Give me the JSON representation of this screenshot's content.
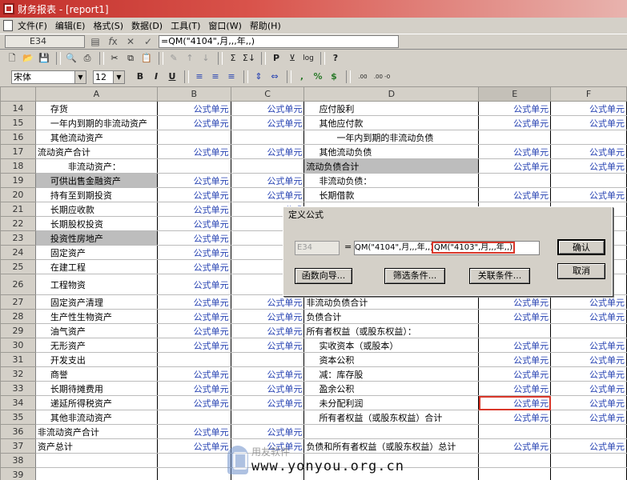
{
  "window": {
    "title": "财务报表 - [report1]"
  },
  "menu": [
    "文件(F)",
    "编辑(E)",
    "格式(S)",
    "数据(D)",
    "工具(T)",
    "窗口(W)",
    "帮助(H)"
  ],
  "formula_bar": {
    "cell_ref": "E34",
    "formula": "=QM(\"4104\",月,,,年,,)"
  },
  "toolbar": {
    "font_name": "宋体",
    "font_size": "12",
    "bold": "B",
    "italic": "I",
    "underline": "U",
    "comma": ",",
    "percent": "%",
    "dollar": "$",
    "dec_inc": ".00 +0",
    "dec_dec": ".00 -0",
    "print": "P",
    "log": "log",
    "help": "?"
  },
  "columns": [
    "A",
    "B",
    "C",
    "D",
    "E",
    "F"
  ],
  "formula_cell": "公式单元",
  "rows": [
    {
      "n": "14",
      "a": "存货",
      "b": "公式单元",
      "c": "公式单元",
      "d": "应付股利",
      "e": "公式单元",
      "f": "公式单元"
    },
    {
      "n": "15",
      "a": "一年内到期的非流动资产",
      "b": "公式单元",
      "c": "公式单元",
      "d": "其他应付款",
      "e": "公式单元",
      "f": "公式单元"
    },
    {
      "n": "16",
      "a": "其他流动资产",
      "b": "",
      "c": "",
      "d": "一年内到期的非流动负债",
      "e": "",
      "f": ""
    },
    {
      "n": "17",
      "a": "流动资产合计",
      "b": "公式单元",
      "c": "公式单元",
      "d": "其他流动负债",
      "e": "公式单元",
      "f": "公式单元"
    },
    {
      "n": "18",
      "a": "非流动资产：",
      "b": "",
      "c": "",
      "d": "流动负债合计",
      "e": "公式单元",
      "f": "公式单元"
    },
    {
      "n": "19",
      "a": "可供出售金融资产",
      "b": "公式单元",
      "c": "公式单元",
      "d": "非流动负债：",
      "e": "",
      "f": ""
    },
    {
      "n": "20",
      "a": "持有至到期投资",
      "b": "公式单元",
      "c": "公式单元",
      "d": "长期借款",
      "e": "公式单元",
      "f": "公式单元"
    },
    {
      "n": "21",
      "a": "长期应收款",
      "b": "公式单元",
      "c": "公式",
      "d": "",
      "e": "",
      "f": ""
    },
    {
      "n": "22",
      "a": "长期股权投资",
      "b": "公式单元",
      "c": "公式",
      "d": "",
      "e": "",
      "f": ""
    },
    {
      "n": "23",
      "a": "投资性房地产",
      "b": "公式单元",
      "c": "公式",
      "d": "",
      "e": "",
      "f": ""
    },
    {
      "n": "24",
      "a": "固定资产",
      "b": "公式单元",
      "c": "公式",
      "d": "",
      "e": "",
      "f": ""
    },
    {
      "n": "25",
      "a": "在建工程",
      "b": "公式单元",
      "c": "公式",
      "d": "",
      "e": "",
      "f": ""
    },
    {
      "n": "26",
      "a": "工程物资",
      "b": "公式单元",
      "c": "公式",
      "d": "",
      "e": "",
      "f": ""
    },
    {
      "n": "27",
      "a": "固定资产清理",
      "b": "公式单元",
      "c": "公式单元",
      "d": "非流动负债合计",
      "e": "公式单元",
      "f": "公式单元"
    },
    {
      "n": "28",
      "a": "生产性生物资产",
      "b": "公式单元",
      "c": "公式单元",
      "d": "负债合计",
      "e": "公式单元",
      "f": "公式单元"
    },
    {
      "n": "29",
      "a": "油气资产",
      "b": "公式单元",
      "c": "公式单元",
      "d": "所有者权益（或股东权益）：",
      "e": "",
      "f": ""
    },
    {
      "n": "30",
      "a": "无形资产",
      "b": "公式单元",
      "c": "公式单元",
      "d": "实收资本（或股本）",
      "e": "公式单元",
      "f": "公式单元"
    },
    {
      "n": "31",
      "a": "开发支出",
      "b": "",
      "c": "",
      "d": "资本公积",
      "e": "公式单元",
      "f": "公式单元"
    },
    {
      "n": "32",
      "a": "商誉",
      "b": "公式单元",
      "c": "公式单元",
      "d": "减：库存股",
      "e": "公式单元",
      "f": "公式单元"
    },
    {
      "n": "33",
      "a": "长期待摊费用",
      "b": "公式单元",
      "c": "公式单元",
      "d": "盈余公积",
      "e": "公式单元",
      "f": "公式单元"
    },
    {
      "n": "34",
      "a": "递延所得税资产",
      "b": "公式单元",
      "c": "公式单元",
      "d": "未分配利润",
      "e": "公式单元",
      "f": "公式单元"
    },
    {
      "n": "35",
      "a": "其他非流动资产",
      "b": "",
      "c": "",
      "d": "所有者权益（或股东权益）合计",
      "e": "公式单元",
      "f": "公式单元"
    },
    {
      "n": "36",
      "a": "非流动资产合计",
      "b": "公式单元",
      "c": "公式单元",
      "d": "",
      "e": "",
      "f": ""
    },
    {
      "n": "37",
      "a": "资产总计",
      "b": "公式单元",
      "c": "公式单元",
      "d": "负债和所有者权益（或股东权益）总计",
      "e": "公式单元",
      "f": "公式单元"
    },
    {
      "n": "38",
      "a": "",
      "b": "",
      "c": "",
      "d": "",
      "e": "",
      "f": ""
    },
    {
      "n": "39",
      "a": "",
      "b": "",
      "c": "",
      "d": "",
      "e": "",
      "f": ""
    }
  ],
  "dialog": {
    "title": "定义公式",
    "cell": "E34",
    "eq": "=",
    "expr_part1": "QM(\"4104\",月,,,年,,)",
    "expr_highlight": "QM(\"4103\",月,,,年,,)",
    "btn_wizard": "函数向导...",
    "btn_filter": "筛选条件...",
    "btn_relation": "关联条件...",
    "btn_ok": "确认",
    "btn_cancel": "取消"
  },
  "watermark": {
    "cn": "用友软件",
    "url": "www.yonyou.org.cn"
  }
}
